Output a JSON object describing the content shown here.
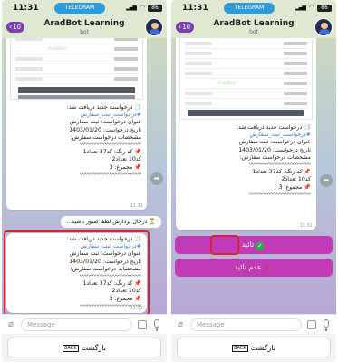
{
  "status_bar": {
    "time": "11:31",
    "app_label": "TELEGRAM",
    "battery": "86"
  },
  "header": {
    "title": "AradBot Learning",
    "subtitle": "bot",
    "unread_count": "10"
  },
  "order_message": {
    "lines": [
      "📑 درخواست جدید دریافت شد:",
      "#درخواست_ثبت_سفارش",
      "عنوان درخواست: ثبت سفارش",
      "تاریخ درخواست: 1403/01/20",
      "مشخصات درخواست سفارش:",
      "〰〰〰〰〰〰〰〰〰〰〰",
      "📌 کد رنگ: کد37 تعداد1",
      "کد10 تعداد2",
      "📌 مجموع: 3",
      "〰〰〰〰〰〰〰〰〰〰〰"
    ],
    "time": "11:31"
  },
  "wait_message": {
    "text": "⏳ درحال پردازش لطفا صبور باشید..."
  },
  "form_watermark": "AradBot",
  "reply_buttons": {
    "confirm": "تائید",
    "reject": "عدم تائید",
    "confirm_emoji": "✓",
    "reject_emoji": "✕"
  },
  "input": {
    "placeholder": "Message"
  },
  "keyboard": {
    "back_label": "بازگشت",
    "back_icon": "BACK"
  },
  "icons": {
    "share": "share-icon",
    "attach": "paperclip-icon",
    "mic": "microphone-icon",
    "keyboard": "keyboard-icon",
    "back": "back-arrow-icon"
  },
  "colors": {
    "accent": "#c23ab5",
    "highlight": "#d7252f",
    "badge": "#7a3fb0",
    "telegram": "#2f9bd8"
  }
}
